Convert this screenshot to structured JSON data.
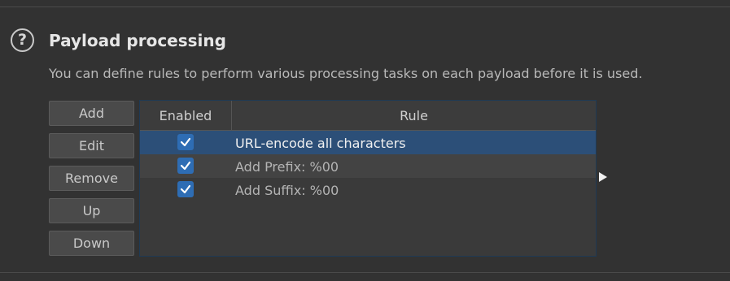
{
  "section": {
    "title": "Payload processing",
    "description": "You can define rules to perform various processing tasks on each payload before it is used."
  },
  "buttons": {
    "add": "Add",
    "edit": "Edit",
    "remove": "Remove",
    "up": "Up",
    "down": "Down"
  },
  "table": {
    "columns": [
      "Enabled",
      "Rule"
    ],
    "rows": [
      {
        "enabled": true,
        "rule": "URL-encode all characters",
        "selected": true
      },
      {
        "enabled": true,
        "rule": "Add Prefix: %00",
        "selected": false
      },
      {
        "enabled": true,
        "rule": "Add Suffix: %00",
        "selected": false
      }
    ]
  },
  "colors": {
    "background": "#323232",
    "selected_row": "#2c4f78",
    "checkbox": "#2e6db4"
  },
  "icons": {
    "help": "help-circle-icon",
    "checkbox": "check-icon",
    "arrow": "play-arrow-icon"
  }
}
